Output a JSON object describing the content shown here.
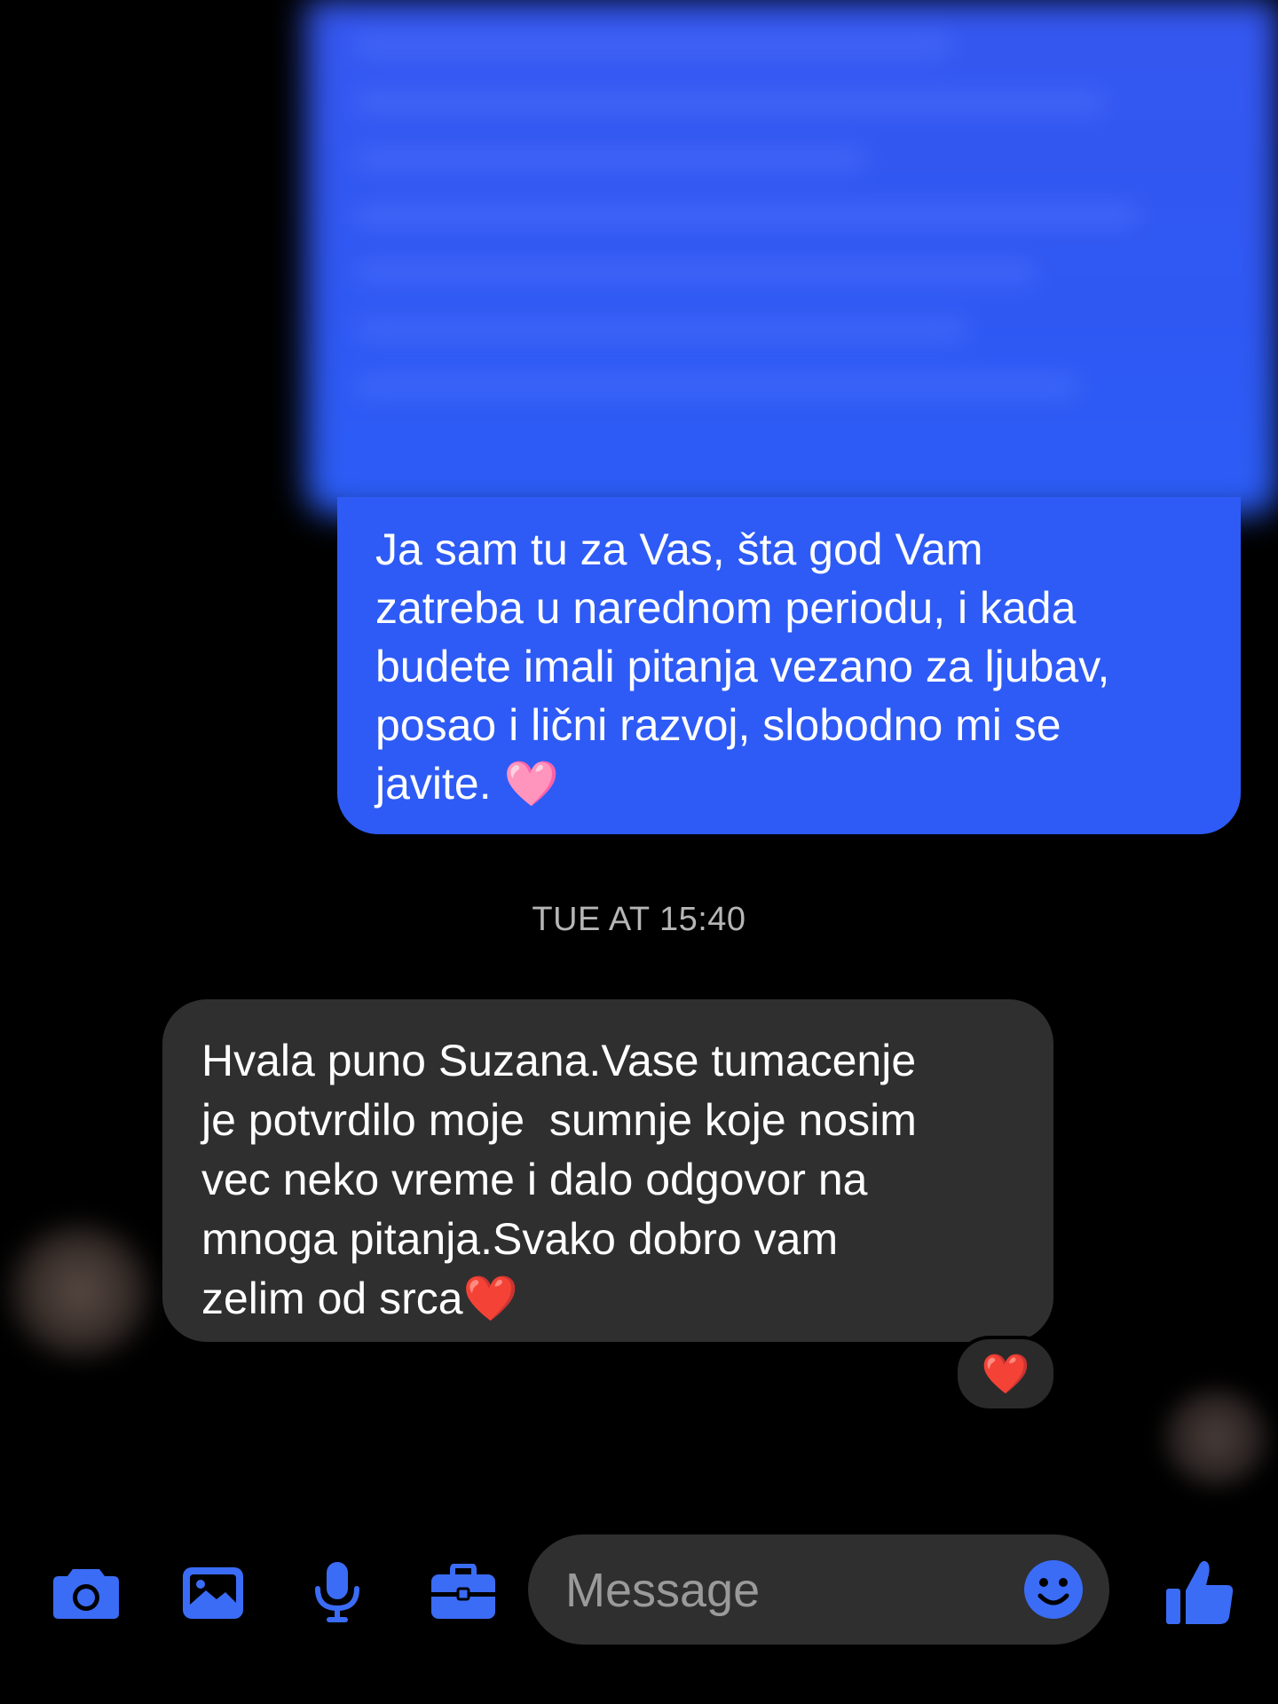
{
  "conversation": {
    "outgoing_message": "Ja sam tu za Vas, šta god Vam\nzatreba u narednom periodu, i kada\nbudete imali pitanja vezano za ljubav,\nposao i lični razvoj, slobodno mi se\njavite. 🩷",
    "timestamp": "TUE AT 15:40",
    "incoming_message": "Hvala puno Suzana.Vase tumacenje\nje potvrdilo moje  sumnje koje nosim\nvec neko vreme i dalo odgovor na\nmnoga pitanja.Svako dobro vam\nzelim od srca❤️",
    "reaction": "❤️"
  },
  "composer": {
    "placeholder": "Message",
    "icons": [
      "camera-icon",
      "image-icon",
      "microphone-icon",
      "briefcase-icon",
      "emoji-icon",
      "thumbs-up-icon"
    ]
  },
  "colors": {
    "accent": "#2e5bf5",
    "incoming_bubble": "#2f2f2f",
    "background": "#000000",
    "icon_blue": "#3b6cf6"
  }
}
